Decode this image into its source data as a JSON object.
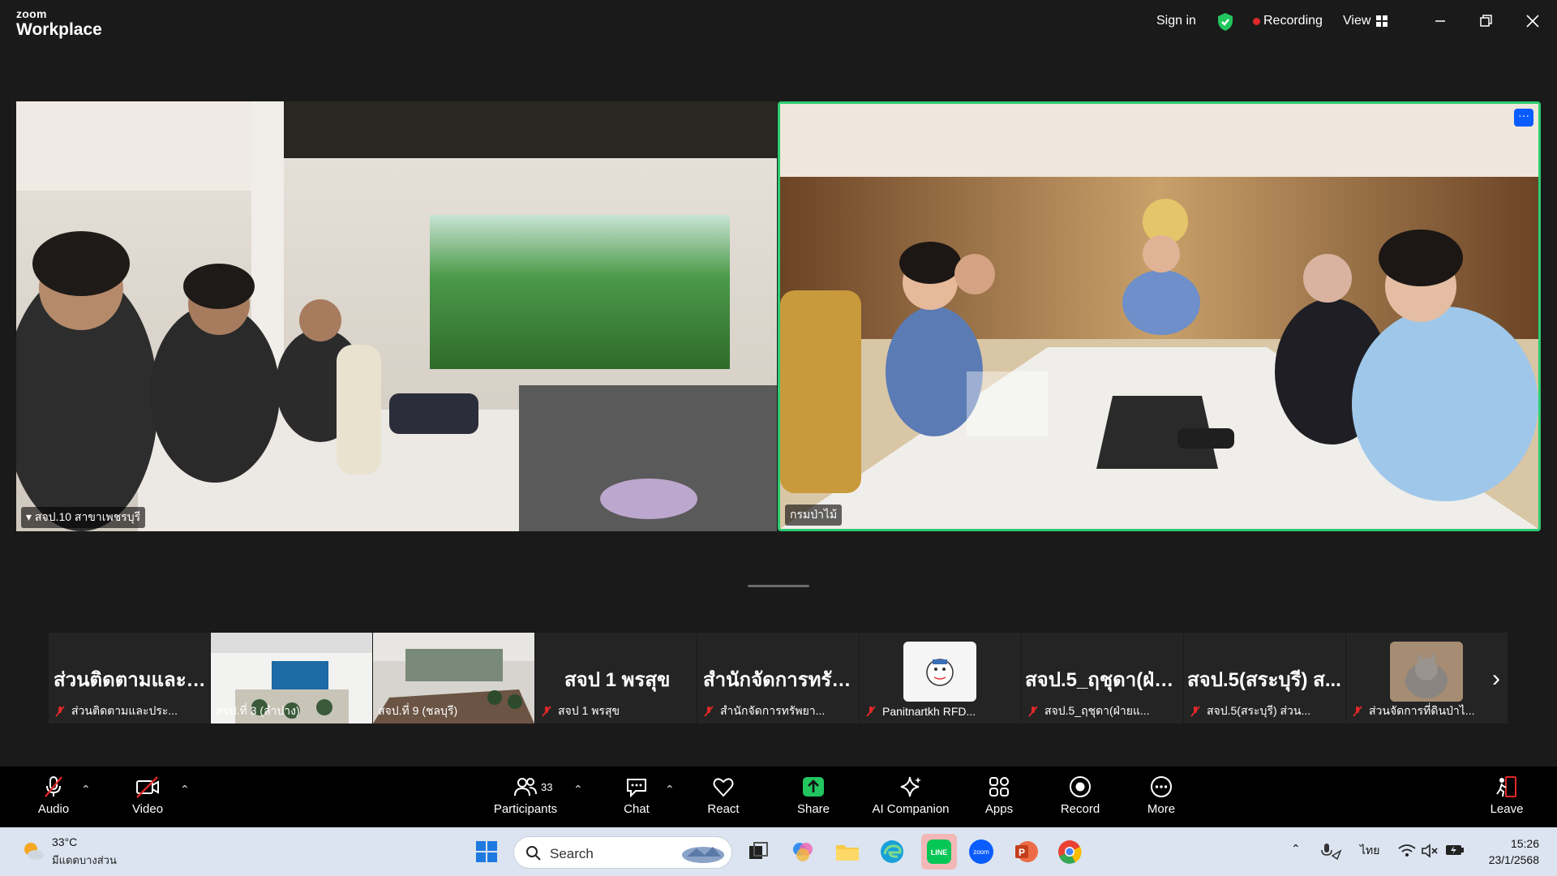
{
  "titlebar": {
    "brand_top": "zoom",
    "brand_bottom": "Workplace",
    "signin_label": "Sign in",
    "recording_label": "Recording",
    "view_label": "View"
  },
  "main_videos": [
    {
      "label": "สจป.10 สาขาเพชรบุรี"
    },
    {
      "label": "กรมป่าไม้"
    }
  ],
  "thumbnails": [
    {
      "name": "ส่วนติดตามและป...",
      "label": "ส่วนติดตามและประ..."
    },
    {
      "name": "",
      "label": "สจป.ที่ 3 (ลำปาง)"
    },
    {
      "name": "",
      "label": "สจป.ที่ 9 (ชลบุรี)"
    },
    {
      "name": "สจป 1 พรสุข",
      "label": "สจป 1 พรสุข"
    },
    {
      "name": "สำนักจัดการทรัพ...",
      "label": "สำนักจัดการทรัพยา..."
    },
    {
      "name": "",
      "label": "Panitnartkh RFD..."
    },
    {
      "name": "สจป.5_ฤชุดา(ฝ่าย...",
      "label": "สจป.5_ฤชุดา(ฝ่ายแ..."
    },
    {
      "name": "สจป.5(สระบุรี) ส...",
      "label": "สจป.5(สระบุรี) ส่วน..."
    },
    {
      "name": "",
      "label": "ส่วนจัดการที่ดินป่าไ..."
    }
  ],
  "toolbar": {
    "audio": "Audio",
    "video": "Video",
    "participants": "Participants",
    "participants_count": "33",
    "chat": "Chat",
    "react": "React",
    "share": "Share",
    "ai": "AI Companion",
    "apps": "Apps",
    "record": "Record",
    "more": "More",
    "leave": "Leave"
  },
  "taskbar": {
    "temp": "33°C",
    "weather_desc": "มีแดดบางส่วน",
    "search_placeholder": "Search",
    "lang": "ไทย",
    "time": "15:26",
    "date": "23/1/2568"
  },
  "colors": {
    "active_speaker": "#2ecc71",
    "recording": "#e02828",
    "share_green": "#22c55e",
    "muted_red": "#e02828"
  }
}
